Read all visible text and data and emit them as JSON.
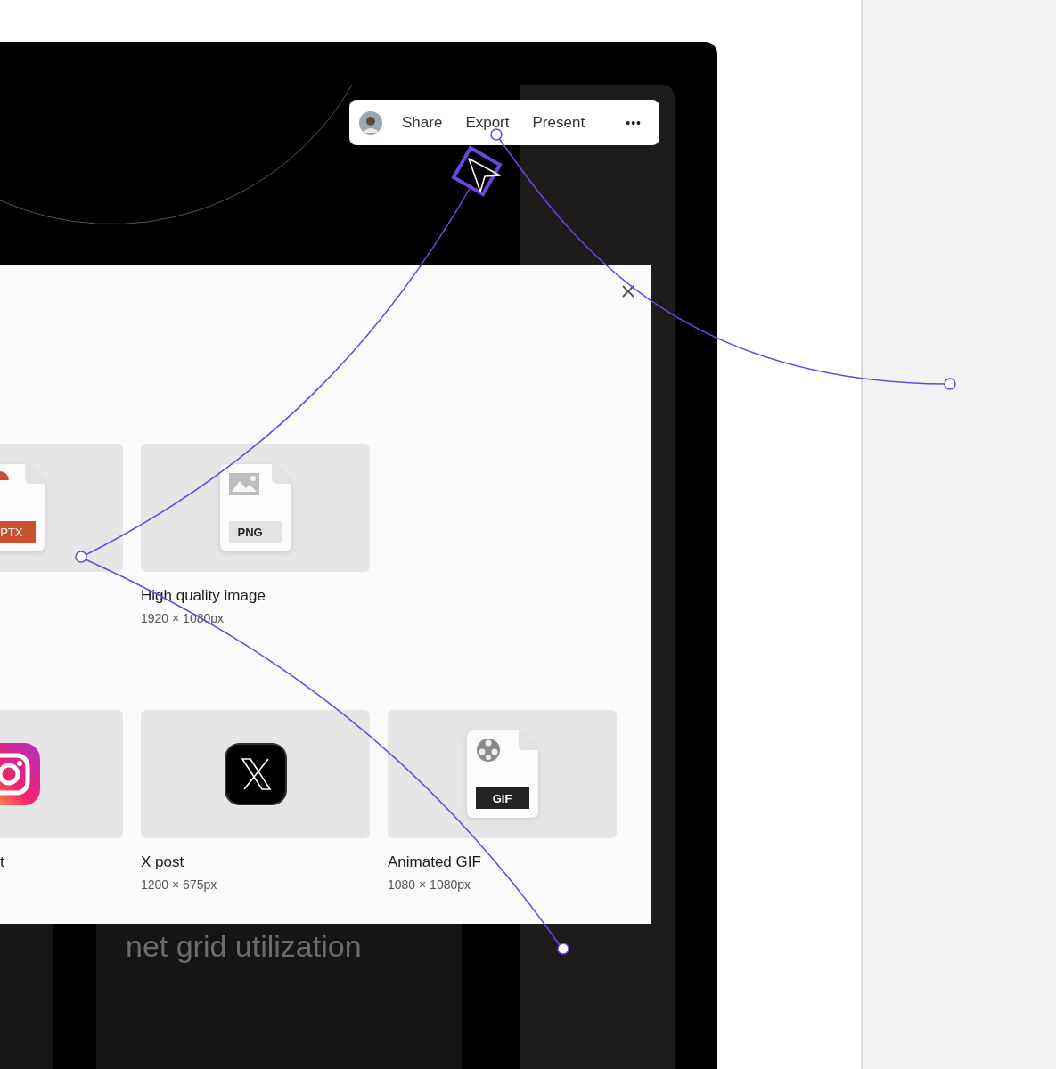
{
  "toolbar": {
    "items": [
      {
        "label": "Share"
      },
      {
        "label": "Export"
      },
      {
        "label": "Present"
      }
    ],
    "more": "•••"
  },
  "cards": [
    {
      "kind": "pptx",
      "badge": "PTX"
    },
    {
      "kind": "png",
      "badge": "PNG",
      "label": "High quality image",
      "size": "1920 × 1080px"
    },
    {
      "kind": "instagram",
      "label": "t"
    },
    {
      "kind": "x",
      "label": "X post",
      "size": "1200 × 675px"
    },
    {
      "kind": "gif",
      "badge": "GIF",
      "label": "Animated GIF",
      "size": "1080 × 1080px"
    }
  ],
  "background_text": "net grid utilization"
}
